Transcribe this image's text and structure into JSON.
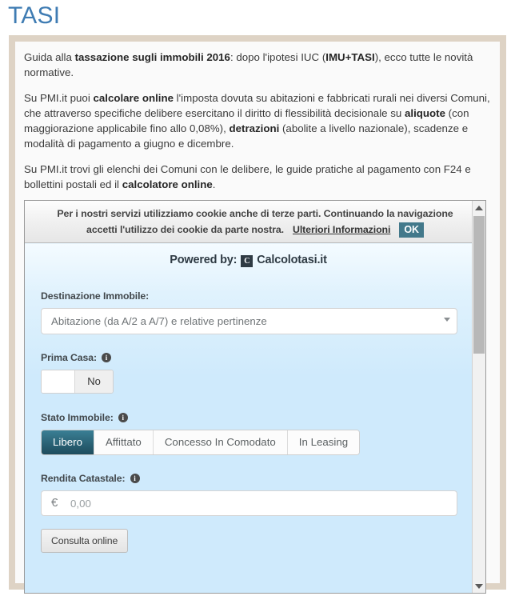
{
  "page": {
    "title": "TASI",
    "title_color": "#3f7cb3",
    "frame_color": "#ded3c5"
  },
  "intro": {
    "p1": {
      "seg1": "Guida alla ",
      "b1": "tassazione sugli immobili 2016",
      "seg2": ": dopo l'ipotesi IUC (",
      "b2": "IMU+TASI",
      "seg3": "), ecco tutte le novità normative."
    },
    "p2": {
      "seg1": "Su PMI.it puoi ",
      "b1": "calcolare online",
      "seg2": " l'imposta dovuta su abitazioni e fabbricati rurali nei diversi Comuni, che attraverso specifiche delibere esercitano il diritto di flessibilità decisionale su ",
      "b2": "aliquote",
      "seg3": " (con maggiorazione applicabile fino allo 0,08%), ",
      "b3": "detrazioni",
      "seg4": " (abolite a livello nazionale), scadenze e modalità di pagamento a giugno e dicembre."
    },
    "p3": {
      "seg1": "Su PMI.it trovi gli elenchi dei Comuni con le delibere, le guide pratiche al pagamento con F24 e bollettini postali ed il ",
      "b1": "calcolatore online",
      "seg2": "."
    }
  },
  "widget": {
    "cookie": {
      "line1": "Per i nostri servizi utilizziamo cookie anche di terze parti. Continuando la navigazione",
      "line2": "accetti l'utilizzo dei cookie da parte nostra.",
      "link": "Ulteriori Informazioni",
      "ok_label": "OK",
      "ok_color": "#43798b"
    },
    "powered": {
      "prefix": "Powered by:",
      "logo_glyph": "C",
      "brand": "Calcolotasi.it"
    },
    "form": {
      "destinazione": {
        "label": "Destinazione Immobile:",
        "selected": "Abitazione (da A/2 a A/7) e relative pertinenze",
        "options": [
          "Abitazione (da A/2 a A/7) e relative pertinenze"
        ],
        "arrow_icon": "chevron-down-icon"
      },
      "prima_casa": {
        "label": "Prima Casa:",
        "info_icon": "info-icon",
        "value": "No",
        "state": "off"
      },
      "stato_immobile": {
        "label": "Stato Immobile:",
        "info_icon": "info-icon",
        "options": [
          "Libero",
          "Affittato",
          "Concesso In Comodato",
          "In Leasing"
        ],
        "selected_index": 0,
        "active_color": "#2a6275"
      },
      "rendita_catastale": {
        "label": "Rendita Catastale:",
        "info_icon": "info-icon",
        "currency": "€",
        "value": "",
        "placeholder": "0,00",
        "button_label": "Consulta online"
      }
    },
    "scrollbar": {
      "up_icon": "triangle-up-icon",
      "down_icon": "triangle-down-icon"
    }
  }
}
